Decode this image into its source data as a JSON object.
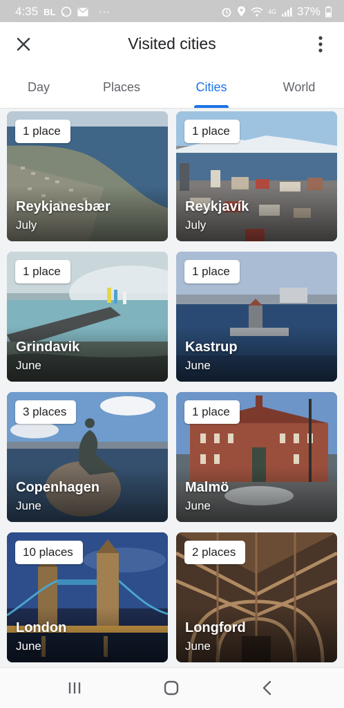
{
  "status_bar": {
    "time": "4:35",
    "carrier": "BL",
    "dots": "···",
    "network": "4G",
    "battery": "37%",
    "icons_left": [
      "whatsapp-icon",
      "mail-icon"
    ],
    "icons_right": [
      "alarm-icon",
      "location-icon",
      "wifi-icon",
      "signal-icon",
      "battery-icon"
    ]
  },
  "app_bar": {
    "title": "Visited cities",
    "close_icon": "close-icon",
    "menu_icon": "more-vert-icon"
  },
  "tabs": [
    {
      "label": "Day",
      "active": false
    },
    {
      "label": "Places",
      "active": false
    },
    {
      "label": "Cities",
      "active": true
    },
    {
      "label": "World",
      "active": false
    }
  ],
  "accent_color": "#1a73e8",
  "cities": [
    {
      "name": "Reykjanesbær",
      "month": "July",
      "count": "1 place"
    },
    {
      "name": "Reykjavík",
      "month": "July",
      "count": "1 place"
    },
    {
      "name": "Grindavik",
      "month": "June",
      "count": "1 place"
    },
    {
      "name": "Kastrup",
      "month": "June",
      "count": "1 place"
    },
    {
      "name": "Copenhagen",
      "month": "June",
      "count": "3 places"
    },
    {
      "name": "Malmö",
      "month": "June",
      "count": "1 place"
    },
    {
      "name": "London",
      "month": "June",
      "count": "10 places"
    },
    {
      "name": "Longford",
      "month": "June",
      "count": "2 places"
    }
  ],
  "nav_bar": {
    "icons": [
      "recent-apps-icon",
      "home-icon",
      "back-icon"
    ]
  }
}
